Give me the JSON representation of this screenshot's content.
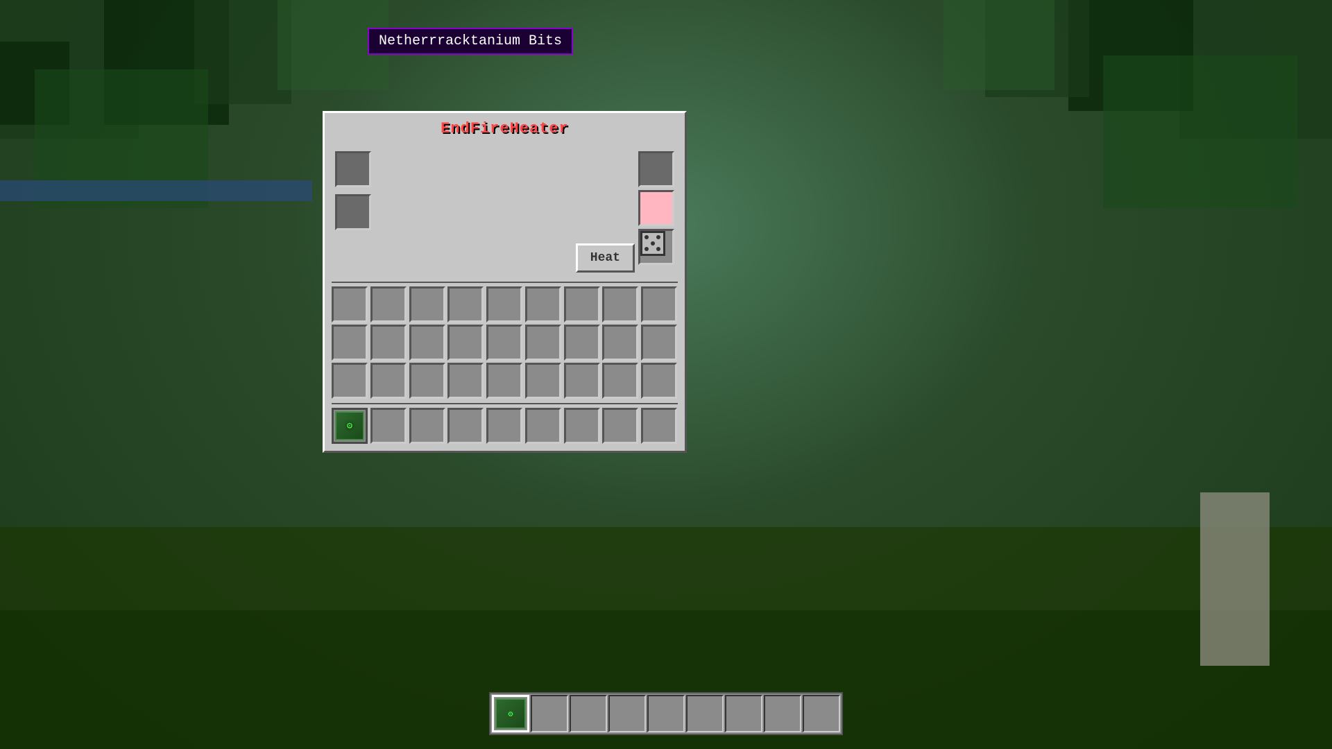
{
  "background": {
    "color": "#2a4a2a"
  },
  "ui": {
    "title": "EndFireHeater",
    "title_color": "#ff4444",
    "tooltip_text": "Netherrracktanium Bits",
    "heat_button_label": "Heat",
    "left_slots": [
      {
        "id": "slot-left-1",
        "empty": true
      },
      {
        "id": "slot-left-2",
        "empty": true
      }
    ],
    "right_slots": [
      {
        "id": "slot-right-top",
        "empty": true,
        "style": "dark"
      },
      {
        "id": "slot-right-pink",
        "empty": true,
        "style": "pink"
      },
      {
        "id": "slot-right-dice",
        "empty": false,
        "style": "dice"
      }
    ],
    "inventory_rows": 3,
    "inventory_cols": 9,
    "hotbar_slots": 9,
    "player_slot_has_item": true,
    "player_slot_index": 0
  }
}
